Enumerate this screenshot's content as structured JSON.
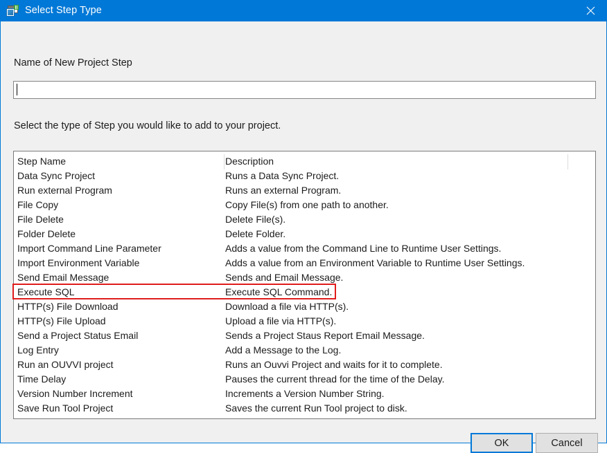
{
  "window": {
    "title": "Select Step Type",
    "icon": "project-step-window-icon",
    "close_icon": "close-icon",
    "accent_color": "#0078d7",
    "background_color": "#f0f0f0"
  },
  "form": {
    "name_label": "Name of New Project Step",
    "name_value": "",
    "name_placeholder": "",
    "instruction": "Select the type of Step you would like to add to your project."
  },
  "list": {
    "columns": [
      "Step Name",
      "Description"
    ],
    "rows": [
      {
        "name": "Data Sync Project",
        "description": "Runs a Data Sync Project."
      },
      {
        "name": "Run external Program",
        "description": "Runs an external Program."
      },
      {
        "name": "File Copy",
        "description": "Copy File(s) from one path to another."
      },
      {
        "name": "File Delete",
        "description": "Delete File(s)."
      },
      {
        "name": "Folder Delete",
        "description": "Delete Folder."
      },
      {
        "name": "Import Command Line Parameter",
        "description": "Adds a value from the Command Line to Runtime User Settings."
      },
      {
        "name": "Import Environment Variable",
        "description": "Adds a value from an Environment Variable to Runtime User Settings."
      },
      {
        "name": "Send Email Message",
        "description": "Sends and Email Message."
      },
      {
        "name": "Execute SQL",
        "description": "Execute SQL Command."
      },
      {
        "name": "HTTP(s) File Download",
        "description": "Download a file via HTTP(s)."
      },
      {
        "name": "HTTP(s) File Upload",
        "description": "Upload a file via HTTP(s)."
      },
      {
        "name": "Send a Project Status Email",
        "description": "Sends a Project Staus Report Email Message."
      },
      {
        "name": "Log Entry",
        "description": "Add a Message to the Log."
      },
      {
        "name": "Run an OUVVI project",
        "description": "Runs an Ouvvi Project and waits for it to complete."
      },
      {
        "name": "Time Delay",
        "description": "Pauses the current thread for the time of the Delay."
      },
      {
        "name": "Version Number Increment",
        "description": "Increments a Version Number String."
      },
      {
        "name": "Save Run Tool Project",
        "description": "Saves the current Run Tool project to disk."
      }
    ]
  },
  "annotation": {
    "highlighted_row": "Execute SQL",
    "color": "#e01b1b"
  },
  "footer": {
    "ok_label": "OK",
    "cancel_label": "Cancel"
  }
}
